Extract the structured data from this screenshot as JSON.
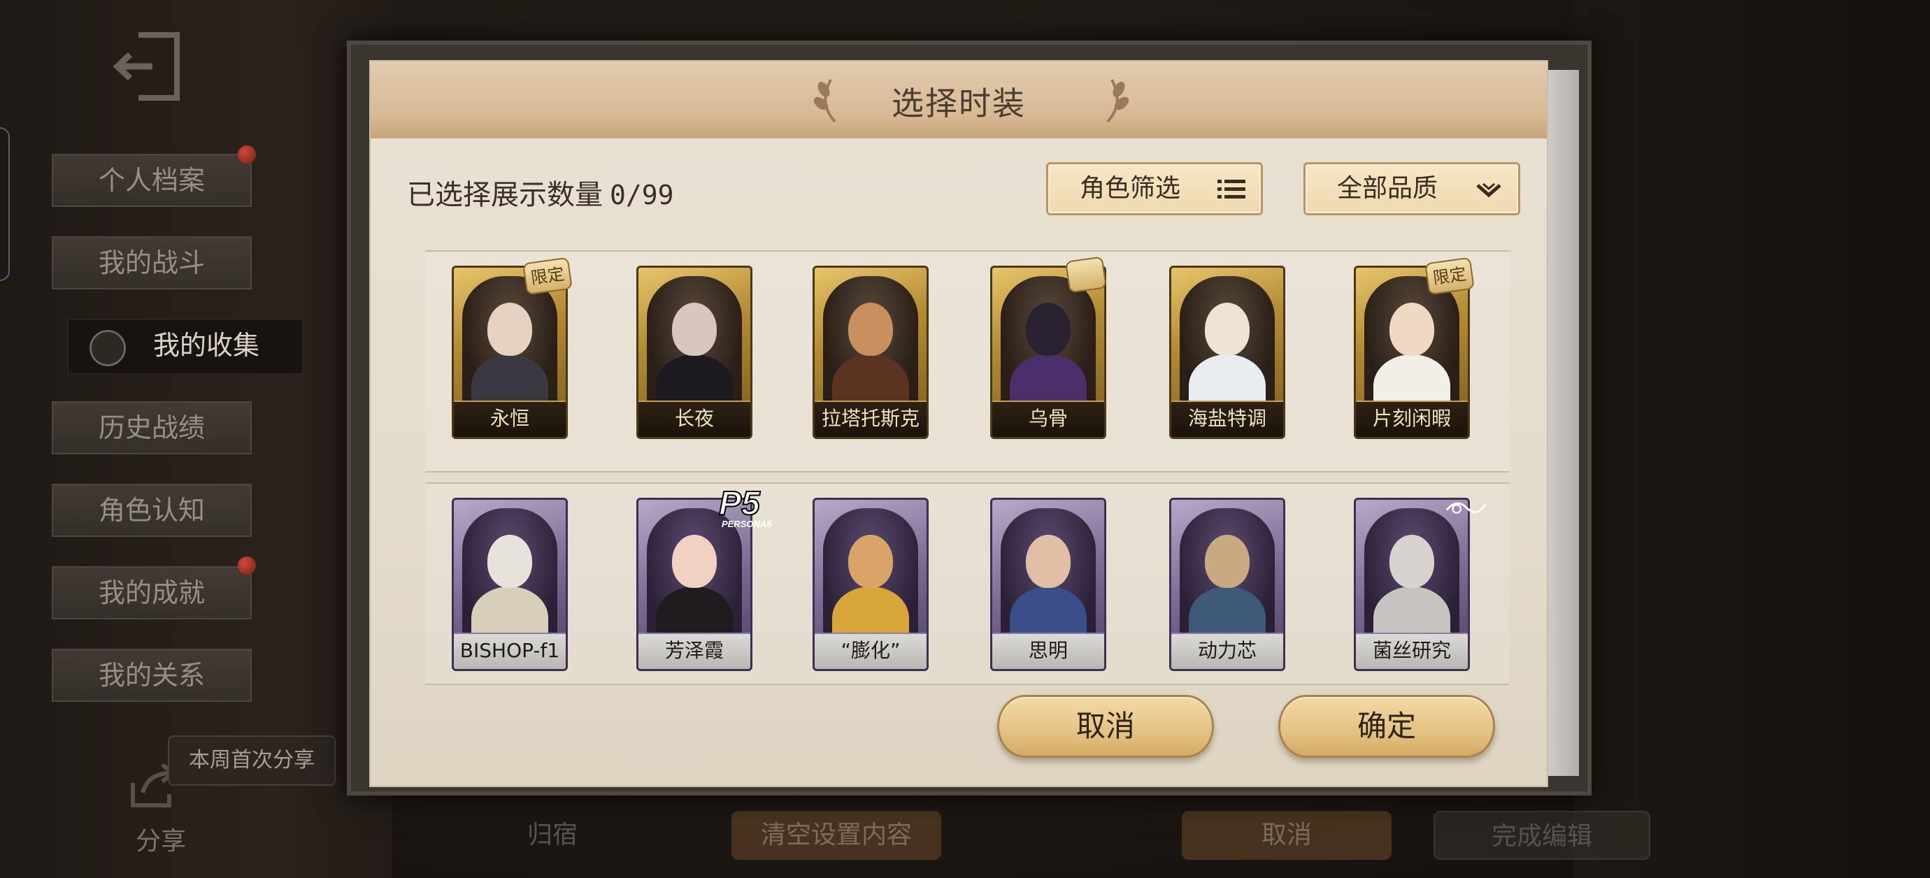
{
  "background": {
    "sidebar": {
      "items": [
        {
          "label": "个人档案",
          "has_notification": true
        },
        {
          "label": "我的战斗",
          "has_notification": false
        },
        {
          "label": "我的收集",
          "active": true,
          "has_notification": false
        },
        {
          "label": "历史战绩",
          "has_notification": false
        },
        {
          "label": "角色认知",
          "has_notification": false
        },
        {
          "label": "我的成就",
          "has_notification": true
        },
        {
          "label": "我的关系",
          "has_notification": false
        }
      ]
    },
    "share": {
      "tooltip": "本周首次分享",
      "label": "分享"
    },
    "bottom_bar": {
      "return_label": "归宿",
      "clear_label": "清空设置内容",
      "cancel_label": "取消",
      "finish_label": "完成编辑"
    }
  },
  "dialog": {
    "title": "选择时装",
    "selected_count_label": "已选择展示数量",
    "selected_count": "0/99",
    "role_filter_label": "角色筛选",
    "quality_filter_label": "全部品质",
    "costume_rows": [
      [
        {
          "name": "永恒",
          "frame": "gold",
          "tag": "限定"
        },
        {
          "name": "长夜",
          "frame": "gold"
        },
        {
          "name": "拉塔托斯克",
          "frame": "gold"
        },
        {
          "name": "乌骨",
          "frame": "gold",
          "tag": "ribbon"
        },
        {
          "name": "海盐特调",
          "frame": "gold"
        },
        {
          "name": "片刻闲暇",
          "frame": "gold",
          "tag": "限定"
        }
      ],
      [
        {
          "name": "BISHOP-f1",
          "frame": "purple"
        },
        {
          "name": "芳泽霞",
          "frame": "purple",
          "badge": "P5 PERSONA5"
        },
        {
          "name": "“膨化”",
          "frame": "purple"
        },
        {
          "name": "思明",
          "frame": "purple"
        },
        {
          "name": "动力芯",
          "frame": "purple"
        },
        {
          "name": "菌丝研究",
          "frame": "purple",
          "badge": "collab-logo"
        }
      ]
    ],
    "cancel_label": "取消",
    "confirm_label": "确定"
  },
  "colors": {
    "panel": "#e6dfd0",
    "header": "#d8b995",
    "button_gold": "#e5c283",
    "card_gold": "#b48a34",
    "card_purple": "#7b6a93"
  }
}
